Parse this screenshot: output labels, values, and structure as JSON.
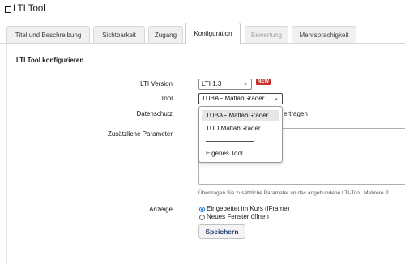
{
  "page": {
    "title": "LTI Tool"
  },
  "tabs": [
    {
      "label": "Titel und Beschreibung",
      "state": "normal"
    },
    {
      "label": "Sichtbarkeit",
      "state": "normal"
    },
    {
      "label": "Zugang",
      "state": "normal"
    },
    {
      "label": "Konfiguration",
      "state": "active"
    },
    {
      "label": "Bewertung",
      "state": "disabled"
    },
    {
      "label": "Mehrsprachigkeit",
      "state": "normal"
    }
  ],
  "section": {
    "title": "LTI Tool konfigurieren"
  },
  "form": {
    "lti_version": {
      "label": "LTI Version",
      "value": "LTI 1.3",
      "badge": "NEW"
    },
    "tool": {
      "label": "Tool",
      "value": "TUBAF MatlabGrader",
      "options": [
        "TUBAF MatlabGrader",
        "TUD MatlabGrader",
        "",
        "Eigenes Tool"
      ]
    },
    "datenschutz": {
      "label": "Datenschutz",
      "partial_text": "ertragen"
    },
    "params": {
      "label": "Zusätzliche Parameter",
      "help": "Übertragen Sie zusätzliche Parameter an das angebundene LTI-Tool. Mehrere P"
    },
    "anzeige": {
      "label": "Anzeige",
      "options": [
        "Eingebettet im Kurs (iFrame)",
        "Neues Fenster öffnen"
      ],
      "selected_index": 0
    },
    "save_label": "Speichern"
  },
  "colors": {
    "accent": "#1a6ed8",
    "badge": "#c9302c"
  }
}
